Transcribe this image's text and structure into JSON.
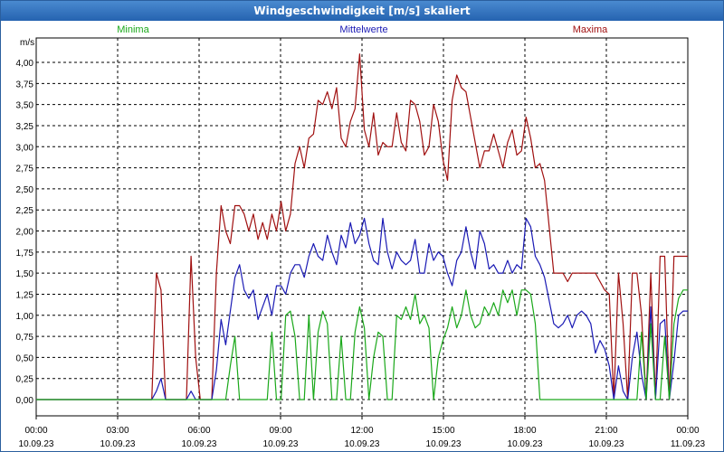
{
  "window": {
    "title": "Windgeschwindigkeit [m/s] skaliert"
  },
  "legend": {
    "minima_label": "Minima",
    "mittel_label": "Mittelwerte",
    "maxima_label": "Maxima"
  },
  "colors": {
    "minima": "#1aa81a",
    "mittel": "#1a1ab4",
    "maxima": "#a01010",
    "grid": "#000000"
  },
  "chart_data": {
    "type": "line",
    "ylabel": "m/s",
    "ylim": [
      0,
      4.2
    ],
    "xlim_hours": [
      0,
      24
    ],
    "grid": true,
    "legend_position": "top",
    "y_ticks": [
      "0,00",
      "0,25",
      "0,50",
      "0,75",
      "1,00",
      "1,25",
      "1,50",
      "1,75",
      "2,00",
      "2,25",
      "2,50",
      "2,75",
      "3,00",
      "3,25",
      "3,50",
      "3,75",
      "4,00"
    ],
    "x_ticks": [
      {
        "time": "00:00",
        "date": "10.09.23"
      },
      {
        "time": "03:00",
        "date": "10.09.23"
      },
      {
        "time": "06:00",
        "date": "10.09.23"
      },
      {
        "time": "09:00",
        "date": "10.09.23"
      },
      {
        "time": "12:00",
        "date": "10.09.23"
      },
      {
        "time": "15:00",
        "date": "10.09.23"
      },
      {
        "time": "18:00",
        "date": "10.09.23"
      },
      {
        "time": "21:00",
        "date": "10.09.23"
      },
      {
        "time": "00:00",
        "date": "11.09.23"
      }
    ],
    "series": [
      {
        "name": "Maxima",
        "points": [
          [
            0,
            0
          ],
          [
            5.0,
            0
          ],
          [
            5.2,
            1.5
          ],
          [
            5.4,
            1.3
          ],
          [
            5.6,
            0
          ],
          [
            6.5,
            0
          ],
          [
            6.7,
            1.7
          ],
          [
            6.9,
            0.5
          ],
          [
            7.1,
            0
          ],
          [
            7.6,
            0
          ],
          [
            7.8,
            1.5
          ],
          [
            8.0,
            2.3
          ],
          [
            8.2,
            2.0
          ],
          [
            8.4,
            1.85
          ],
          [
            8.6,
            2.3
          ],
          [
            8.8,
            2.3
          ],
          [
            9.0,
            2.2
          ],
          [
            9.2,
            2.0
          ],
          [
            9.4,
            2.2
          ],
          [
            9.6,
            1.9
          ],
          [
            9.8,
            2.1
          ],
          [
            10.0,
            1.9
          ],
          [
            10.2,
            2.2
          ],
          [
            10.4,
            2.0
          ],
          [
            10.6,
            2.35
          ],
          [
            10.8,
            2.0
          ],
          [
            11.0,
            2.2
          ],
          [
            11.2,
            2.8
          ],
          [
            11.4,
            3.0
          ],
          [
            11.6,
            2.75
          ],
          [
            11.8,
            3.1
          ],
          [
            12.0,
            3.15
          ],
          [
            12.2,
            3.55
          ],
          [
            12.4,
            3.5
          ],
          [
            12.6,
            3.65
          ],
          [
            12.8,
            3.45
          ],
          [
            13.0,
            3.7
          ],
          [
            13.2,
            3.1
          ],
          [
            13.4,
            3.0
          ],
          [
            13.6,
            3.3
          ],
          [
            13.8,
            3.45
          ],
          [
            14.0,
            4.1
          ],
          [
            14.2,
            3.2
          ],
          [
            14.4,
            3.0
          ],
          [
            14.6,
            3.4
          ],
          [
            14.8,
            2.9
          ],
          [
            15.0,
            3.05
          ],
          [
            15.2,
            3.0
          ],
          [
            15.4,
            3.0
          ],
          [
            15.6,
            3.4
          ],
          [
            15.8,
            3.05
          ],
          [
            16.0,
            2.95
          ],
          [
            16.2,
            3.55
          ],
          [
            16.4,
            3.5
          ],
          [
            16.6,
            3.3
          ],
          [
            16.8,
            2.9
          ],
          [
            17.0,
            3.0
          ],
          [
            17.2,
            3.5
          ],
          [
            17.4,
            3.3
          ],
          [
            17.6,
            2.85
          ],
          [
            17.8,
            2.6
          ],
          [
            18.0,
            3.55
          ],
          [
            18.2,
            3.85
          ],
          [
            18.4,
            3.7
          ],
          [
            18.6,
            3.65
          ],
          [
            18.8,
            3.35
          ],
          [
            19.0,
            3.05
          ],
          [
            19.2,
            2.75
          ],
          [
            19.4,
            2.95
          ],
          [
            19.6,
            2.95
          ],
          [
            19.8,
            3.15
          ],
          [
            20.0,
            2.95
          ],
          [
            20.2,
            2.75
          ],
          [
            20.4,
            3.05
          ],
          [
            20.6,
            3.2
          ],
          [
            20.8,
            2.9
          ],
          [
            21.0,
            2.95
          ],
          [
            21.2,
            3.35
          ],
          [
            21.4,
            3.1
          ],
          [
            21.6,
            2.75
          ],
          [
            21.8,
            2.8
          ],
          [
            22.0,
            2.6
          ],
          [
            22.4,
            1.5
          ],
          [
            22.6,
            1.5
          ],
          [
            22.8,
            1.5
          ],
          [
            23.0,
            1.4
          ],
          [
            23.2,
            1.5
          ],
          [
            23.4,
            1.5
          ],
          [
            23.6,
            1.5
          ],
          [
            23.8,
            1.5
          ],
          [
            24.0,
            1.5
          ],
          [
            24.2,
            1.5
          ],
          [
            24.4,
            1.4
          ],
          [
            24.6,
            1.3
          ],
          [
            24.8,
            1.25
          ],
          [
            25.0,
            0
          ],
          [
            25.2,
            1.5
          ],
          [
            25.4,
            0.9
          ],
          [
            25.6,
            0
          ],
          [
            25.8,
            1.5
          ],
          [
            26.0,
            1.5
          ],
          [
            26.2,
            1.0
          ],
          [
            26.4,
            0
          ],
          [
            26.6,
            1.5
          ],
          [
            26.8,
            0
          ],
          [
            27.0,
            1.7
          ],
          [
            27.2,
            1.7
          ],
          [
            27.4,
            0
          ],
          [
            27.6,
            1.7
          ],
          [
            27.8,
            1.7
          ],
          [
            28.0,
            1.7
          ],
          [
            28.2,
            1.7
          ]
        ]
      },
      {
        "name": "Mittelwerte",
        "points": [
          [
            0,
            0
          ],
          [
            5.0,
            0
          ],
          [
            5.2,
            0.1
          ],
          [
            5.4,
            0.25
          ],
          [
            5.6,
            0
          ],
          [
            6.5,
            0
          ],
          [
            6.7,
            0.1
          ],
          [
            6.9,
            0
          ],
          [
            7.6,
            0
          ],
          [
            7.8,
            0.35
          ],
          [
            8.0,
            0.95
          ],
          [
            8.2,
            0.65
          ],
          [
            8.4,
            1.05
          ],
          [
            8.6,
            1.45
          ],
          [
            8.8,
            1.6
          ],
          [
            9.0,
            1.3
          ],
          [
            9.2,
            1.2
          ],
          [
            9.4,
            1.3
          ],
          [
            9.6,
            0.95
          ],
          [
            9.8,
            1.1
          ],
          [
            10.0,
            1.25
          ],
          [
            10.2,
            1.0
          ],
          [
            10.4,
            1.35
          ],
          [
            10.6,
            1.35
          ],
          [
            10.8,
            1.25
          ],
          [
            11.0,
            1.5
          ],
          [
            11.2,
            1.6
          ],
          [
            11.4,
            1.6
          ],
          [
            11.6,
            1.45
          ],
          [
            11.8,
            1.7
          ],
          [
            12.0,
            1.85
          ],
          [
            12.2,
            1.7
          ],
          [
            12.4,
            1.65
          ],
          [
            12.6,
            1.95
          ],
          [
            12.8,
            1.75
          ],
          [
            13.0,
            1.6
          ],
          [
            13.2,
            1.95
          ],
          [
            13.4,
            1.8
          ],
          [
            13.6,
            2.1
          ],
          [
            13.8,
            1.85
          ],
          [
            14.0,
            1.95
          ],
          [
            14.2,
            2.15
          ],
          [
            14.4,
            1.85
          ],
          [
            14.6,
            1.65
          ],
          [
            14.8,
            1.6
          ],
          [
            15.0,
            2.15
          ],
          [
            15.2,
            1.75
          ],
          [
            15.4,
            1.55
          ],
          [
            15.6,
            1.75
          ],
          [
            15.8,
            1.65
          ],
          [
            16.0,
            1.6
          ],
          [
            16.2,
            1.65
          ],
          [
            16.4,
            1.9
          ],
          [
            16.6,
            1.5
          ],
          [
            16.8,
            1.5
          ],
          [
            17.0,
            1.85
          ],
          [
            17.2,
            1.65
          ],
          [
            17.4,
            1.75
          ],
          [
            17.6,
            1.7
          ],
          [
            17.8,
            1.5
          ],
          [
            18.0,
            1.35
          ],
          [
            18.2,
            1.65
          ],
          [
            18.4,
            1.75
          ],
          [
            18.6,
            2.05
          ],
          [
            18.8,
            1.75
          ],
          [
            19.0,
            1.55
          ],
          [
            19.2,
            2.0
          ],
          [
            19.4,
            1.85
          ],
          [
            19.6,
            1.55
          ],
          [
            19.8,
            1.6
          ],
          [
            20.0,
            1.5
          ],
          [
            20.2,
            1.5
          ],
          [
            20.4,
            1.65
          ],
          [
            20.6,
            1.5
          ],
          [
            20.8,
            1.6
          ],
          [
            21.0,
            1.55
          ],
          [
            21.2,
            2.15
          ],
          [
            21.4,
            2.05
          ],
          [
            21.6,
            1.7
          ],
          [
            21.8,
            1.6
          ],
          [
            22.0,
            1.45
          ],
          [
            22.4,
            0.9
          ],
          [
            22.6,
            0.85
          ],
          [
            22.8,
            0.9
          ],
          [
            23.0,
            1.0
          ],
          [
            23.2,
            0.85
          ],
          [
            23.4,
            1.0
          ],
          [
            23.6,
            1.05
          ],
          [
            23.8,
            1.0
          ],
          [
            24.0,
            0.9
          ],
          [
            24.2,
            0.55
          ],
          [
            24.4,
            0.7
          ],
          [
            24.6,
            0.6
          ],
          [
            24.8,
            0.4
          ],
          [
            25.0,
            0
          ],
          [
            25.2,
            0.4
          ],
          [
            25.4,
            0.1
          ],
          [
            25.6,
            0
          ],
          [
            25.8,
            0.5
          ],
          [
            26.0,
            0.8
          ],
          [
            26.2,
            0.3
          ],
          [
            26.4,
            0
          ],
          [
            26.6,
            1.1
          ],
          [
            26.8,
            0
          ],
          [
            27.0,
            0.9
          ],
          [
            27.2,
            0.95
          ],
          [
            27.4,
            0
          ],
          [
            27.6,
            0.45
          ],
          [
            27.8,
            1.0
          ],
          [
            28.0,
            1.05
          ],
          [
            28.2,
            1.05
          ]
        ]
      },
      {
        "name": "Minima",
        "points": [
          [
            0,
            0
          ],
          [
            8.2,
            0
          ],
          [
            8.4,
            0.4
          ],
          [
            8.6,
            0.75
          ],
          [
            8.8,
            0
          ],
          [
            10.0,
            0
          ],
          [
            10.2,
            0.8
          ],
          [
            10.4,
            0
          ],
          [
            10.6,
            0
          ],
          [
            10.8,
            1.0
          ],
          [
            11.0,
            1.05
          ],
          [
            11.2,
            0.75
          ],
          [
            11.4,
            0
          ],
          [
            11.6,
            0
          ],
          [
            11.8,
            1.0
          ],
          [
            12.0,
            0
          ],
          [
            12.2,
            0.8
          ],
          [
            12.4,
            1.05
          ],
          [
            12.6,
            0.9
          ],
          [
            12.8,
            0
          ],
          [
            13.0,
            0
          ],
          [
            13.2,
            0.75
          ],
          [
            13.4,
            0
          ],
          [
            13.6,
            0
          ],
          [
            13.8,
            0.8
          ],
          [
            14.0,
            1.1
          ],
          [
            14.2,
            0.85
          ],
          [
            14.4,
            0
          ],
          [
            14.6,
            0.5
          ],
          [
            14.8,
            0.8
          ],
          [
            15.0,
            0.75
          ],
          [
            15.2,
            0
          ],
          [
            15.4,
            0
          ],
          [
            15.6,
            1.0
          ],
          [
            15.8,
            0.95
          ],
          [
            16.0,
            1.1
          ],
          [
            16.2,
            0.95
          ],
          [
            16.4,
            1.25
          ],
          [
            16.6,
            0.9
          ],
          [
            16.8,
            1.0
          ],
          [
            17.0,
            0.85
          ],
          [
            17.2,
            0
          ],
          [
            17.4,
            0.5
          ],
          [
            17.6,
            0.7
          ],
          [
            17.8,
            0.85
          ],
          [
            18.0,
            1.1
          ],
          [
            18.2,
            0.85
          ],
          [
            18.4,
            1.0
          ],
          [
            18.6,
            1.3
          ],
          [
            18.8,
            1.0
          ],
          [
            19.0,
            0.85
          ],
          [
            19.2,
            0.9
          ],
          [
            19.4,
            1.1
          ],
          [
            19.6,
            1.0
          ],
          [
            19.8,
            1.15
          ],
          [
            20.0,
            1.0
          ],
          [
            20.2,
            1.3
          ],
          [
            20.4,
            1.15
          ],
          [
            20.6,
            1.3
          ],
          [
            20.8,
            1.0
          ],
          [
            21.0,
            1.3
          ],
          [
            21.2,
            1.3
          ],
          [
            21.4,
            1.25
          ],
          [
            21.6,
            0.9
          ],
          [
            21.8,
            0
          ],
          [
            22.0,
            0
          ],
          [
            22.4,
            0
          ],
          [
            26.0,
            0
          ],
          [
            26.2,
            0.8
          ],
          [
            26.4,
            0
          ],
          [
            26.6,
            0.9
          ],
          [
            26.8,
            0
          ],
          [
            27.0,
            0
          ],
          [
            27.2,
            0.75
          ],
          [
            27.4,
            0
          ],
          [
            27.6,
            0.9
          ],
          [
            27.8,
            1.2
          ],
          [
            28.0,
            1.3
          ],
          [
            28.2,
            1.3
          ]
        ]
      }
    ]
  }
}
